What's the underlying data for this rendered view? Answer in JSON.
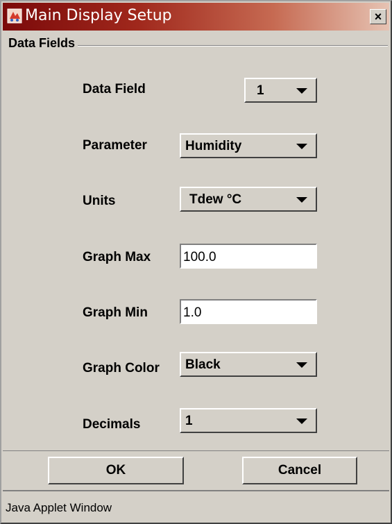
{
  "window": {
    "title": "Main Display Setup",
    "close_glyph": "×",
    "app_icon": "java-applet-icon"
  },
  "group": {
    "title": "Data Fields"
  },
  "form": {
    "data_field": {
      "label": "Data Field",
      "value": "1"
    },
    "parameter": {
      "label": "Parameter",
      "value": "Humidity"
    },
    "units": {
      "label": "Units",
      "value": "Tdew °C"
    },
    "graph_max": {
      "label": "Graph Max",
      "value": "100.0"
    },
    "graph_min": {
      "label": "Graph Min",
      "value": "1.0"
    },
    "graph_color": {
      "label": "Graph Color",
      "value": "Black"
    },
    "decimals": {
      "label": "Decimals",
      "value": "1"
    }
  },
  "buttons": {
    "ok": "OK",
    "cancel": "Cancel"
  },
  "status": {
    "text": "Java Applet Window"
  },
  "colors": {
    "title_start": "#7b0a0a",
    "title_end": "#e6c3b3",
    "panel": "#d4d0c8"
  }
}
